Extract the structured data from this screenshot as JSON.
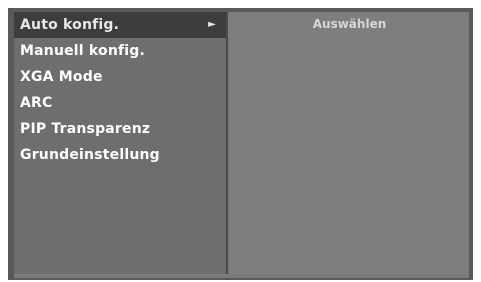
{
  "menu": {
    "items": [
      {
        "label": "Auto konfig.",
        "selected": true
      },
      {
        "label": "Manuell konfig.",
        "selected": false
      },
      {
        "label": "XGA Mode",
        "selected": false
      },
      {
        "label": "ARC",
        "selected": false
      },
      {
        "label": "PIP Transparenz",
        "selected": false
      },
      {
        "label": "Grundeinstellung",
        "selected": false
      }
    ],
    "selected_arrow": "►"
  },
  "submenu": {
    "option": "Auswählen"
  }
}
